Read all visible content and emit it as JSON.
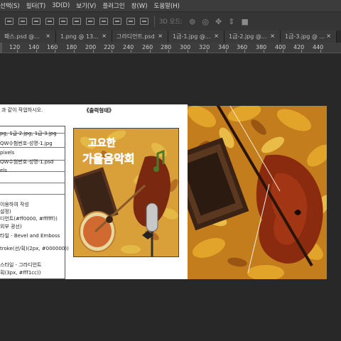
{
  "menubar": {
    "items": [
      "선택(S)",
      "필터(T)",
      "3D(D)",
      "보기(V)",
      "플러그인",
      "창(W)",
      "도움말(H)"
    ]
  },
  "optionsbar": {
    "mode_3d": "3D 모드:"
  },
  "tabs": [
    {
      "label": "패스.psd @..."
    },
    {
      "label": "1.png @ 13..."
    },
    {
      "label": "그라디언트.psd"
    },
    {
      "label": "1급-1.jpg @..."
    },
    {
      "label": "1급-2.jpg @..."
    },
    {
      "label": "1급-3.jpg @ ..."
    }
  ],
  "ruler": {
    "labels": [
      "120",
      "140",
      "160",
      "180",
      "200",
      "220",
      "240",
      "260",
      "280",
      "300",
      "320",
      "340",
      "360",
      "380",
      "400",
      "420",
      "440"
    ]
  },
  "document": {
    "intro": "과 같이 작업하시오.",
    "output_label": "《출력형태》",
    "lines": [
      "pg, 1급-2.jpg, 1급-3.jpg",
      "QW수험번호-성명-1.jpg",
      "pixels",
      "QW수험번호-성명-1.psd",
      "els",
      "이용하여 작성",
      "설정)",
      "디언트(#ff0000, #ffffff))",
      "외부 광선)",
      "타일 - Bevel and Emboss",
      "troke(선/획)(2px, #000000))",
      "스타일 - 그라디언트",
      "획(3px, #fff1cc))"
    ],
    "poster_title_1": "고요한",
    "poster_title_2": "가을음악회"
  },
  "colors": {
    "app_bg": "#282828",
    "menubar": "#3c3c3c",
    "tab_bg": "#3a3a3a"
  }
}
